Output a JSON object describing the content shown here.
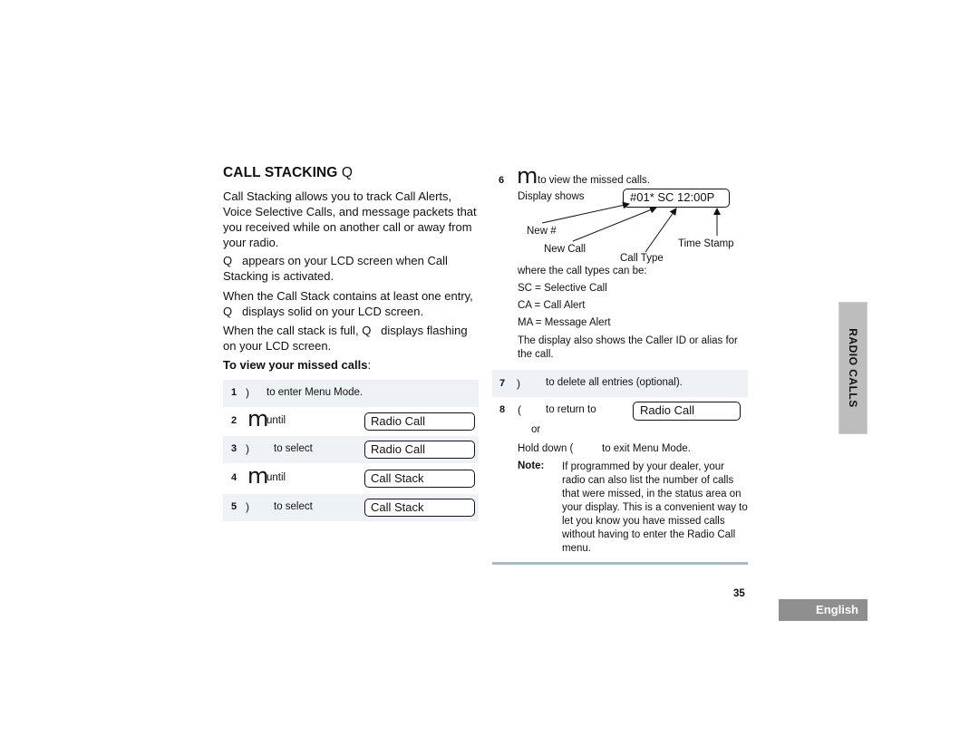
{
  "section": {
    "title": "CALL STACKING",
    "title_icon_glyph": "Q",
    "title_icon_name": "call-stack-icon",
    "paragraphs": [
      "Call Stacking allows you to track Call Alerts, Voice Selective Calls, and message packets that you received while on another call or away from your radio.",
      "appears on your LCD screen when Call Stacking is activated.",
      "When the Call Stack contains at least one entry,",
      "displays solid on your LCD screen.",
      "When the call stack is full,",
      "displays flashing on your LCD screen."
    ],
    "icon_glyph": "Q",
    "subheading": "To view your missed calls",
    "subheading_colon": ":"
  },
  "steps_left": [
    {
      "num": "1",
      "key": ")",
      "key_name": "menu-select-button-icon",
      "text": "to enter Menu Mode.",
      "lcd": null
    },
    {
      "num": "2",
      "key": "m",
      "key_name": "scroll-button-icon",
      "text": "until",
      "lcd": "Radio Call"
    },
    {
      "num": "3",
      "key": ")",
      "key_name": "menu-select-button-icon",
      "text": "to select",
      "lcd": "Radio Call"
    },
    {
      "num": "4",
      "key": "m",
      "key_name": "scroll-button-icon",
      "text": "until",
      "lcd": "Call Stack"
    },
    {
      "num": "5",
      "key": ")",
      "key_name": "menu-select-button-icon",
      "text": "to select",
      "lcd": "Call Stack"
    }
  ],
  "step6": {
    "num": "6",
    "key": "m",
    "text": "to view the missed calls.",
    "display_label": "Display shows",
    "display_value": "#01* SC 12:00P",
    "callouts": [
      "New #",
      "New Call",
      "Call Type",
      "Time Stamp"
    ],
    "types_intro": "where the call types can be:",
    "types": [
      "SC = Selective Call",
      "CA = Call Alert",
      "MA = Message Alert"
    ],
    "caller_id_text": "The display also shows the Caller ID or alias for the call."
  },
  "step7": {
    "num": "7",
    "key": ")",
    "text": "to delete all entries (optional)."
  },
  "step8": {
    "num": "8",
    "key": "(",
    "text": "to return to",
    "lcd": "Radio Call",
    "or": "or",
    "hold_prefix": "Hold down (",
    "hold_suffix": "to exit Menu Mode."
  },
  "note": {
    "label": "Note:",
    "text": "If programmed by your dealer, your radio can also list the number of calls that were missed, in the status area on your display.  This is a convenient way to let you know you have missed calls without having to enter the Radio Call menu."
  },
  "side_tab": "RADIO CALLS",
  "page_number": "35",
  "language_tab": "English"
}
